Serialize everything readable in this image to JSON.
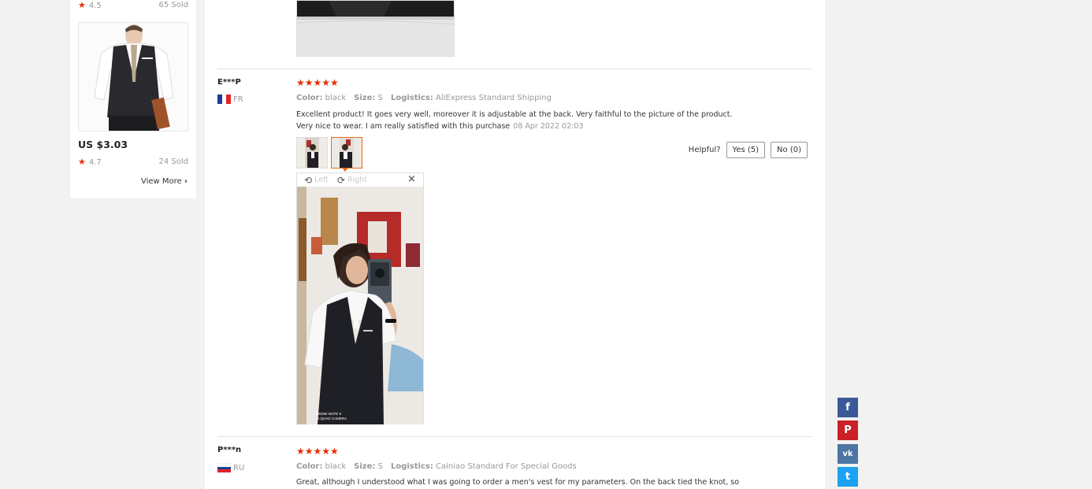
{
  "recommendations": [
    {
      "rating": "4.5",
      "sold": "65 Sold"
    },
    {
      "price": "US $3.03",
      "rating": "4.7",
      "sold": "24 Sold"
    }
  ],
  "view_more": "View More",
  "view_more_chevron": "›",
  "reviews": [
    {
      "user": "E***P",
      "country": "FR",
      "stars": "★★★★★",
      "color_label": "Color:",
      "color": "black",
      "size_label": "Size:",
      "size": "S",
      "logistics_label": "Logistics:",
      "logistics": "AliExpress Standard Shipping",
      "text_line1": "Excellent product! It goes very well, moreover it is adjustable at the back. Very faithful to the picture of the product.",
      "text_line2": "Very nice to wear. I am really satisfied with this purchase",
      "date": "08 Apr 2022 02:03",
      "helpful_label": "Helpful?",
      "yes": "Yes (5)",
      "no": "No (0)",
      "viewer": {
        "left": "Left",
        "right": "Right",
        "close": "×",
        "watermark_line1": "REDMI NOTE 9",
        "watermark_line2": "AI QUAD CAMERA"
      }
    },
    {
      "user": "P***n",
      "country": "RU",
      "stars": "★★★★★",
      "color_label": "Color:",
      "color": "black",
      "size_label": "Size:",
      "size": "S",
      "logistics_label": "Logistics:",
      "logistics": "Cainiao Standard For Special Goods",
      "text_line1": "Great, although I understood what I was going to order a men's vest for my parameters. On the back tied the knot, so"
    }
  ],
  "share": {
    "facebook": "f",
    "pinterest": "P",
    "vk": "vk",
    "twitter": "t"
  },
  "colors": {
    "star": "#e62e04",
    "accent": "#e56a1b",
    "facebook": "#3b5998",
    "pinterest": "#cb2027",
    "vk": "#4c75a3",
    "twitter": "#1da1f2"
  }
}
